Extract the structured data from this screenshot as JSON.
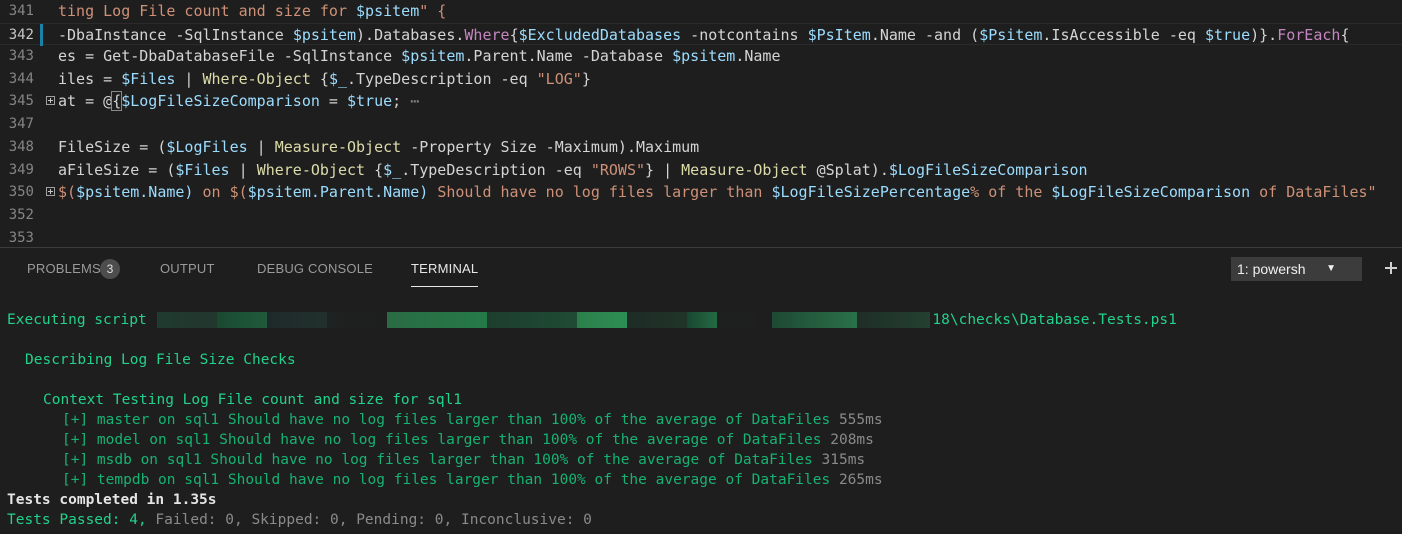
{
  "editor": {
    "lines": [
      {
        "num": "341",
        "fold": false,
        "segments": [
          {
            "t": "ting Log File count and size for ",
            "c": "str"
          },
          {
            "t": "$psitem",
            "c": "var"
          },
          {
            "t": "\" {",
            "c": "str"
          }
        ]
      },
      {
        "num": "342",
        "fold": false,
        "current": true,
        "segments": [
          {
            "t": "-DbaInstance -SqlInstance ",
            "c": "def"
          },
          {
            "t": "$psitem",
            "c": "var"
          },
          {
            "t": ").Databases.",
            "c": "def"
          },
          {
            "t": "Where",
            "c": "kw"
          },
          {
            "t": "{",
            "c": "def"
          },
          {
            "t": "$ExcludedDatabases",
            "c": "var"
          },
          {
            "t": " -notcontains ",
            "c": "def"
          },
          {
            "t": "$PsItem",
            "c": "var"
          },
          {
            "t": ".Name -and (",
            "c": "def"
          },
          {
            "t": "$Psitem",
            "c": "var"
          },
          {
            "t": ".IsAccessible -eq ",
            "c": "def"
          },
          {
            "t": "$true",
            "c": "var"
          },
          {
            "t": ")}.",
            "c": "def"
          },
          {
            "t": "ForEach",
            "c": "kw"
          },
          {
            "t": "{",
            "c": "def"
          }
        ]
      },
      {
        "num": "343",
        "fold": false,
        "segments": [
          {
            "t": "es = Get-DbaDatabaseFile -SqlInstance ",
            "c": "def"
          },
          {
            "t": "$psitem",
            "c": "var"
          },
          {
            "t": ".Parent.Name -Database ",
            "c": "def"
          },
          {
            "t": "$psitem",
            "c": "var"
          },
          {
            "t": ".Name",
            "c": "def"
          }
        ]
      },
      {
        "num": "344",
        "fold": false,
        "segments": [
          {
            "t": "iles = ",
            "c": "def"
          },
          {
            "t": "$Files",
            "c": "var"
          },
          {
            "t": " | ",
            "c": "def"
          },
          {
            "t": "Where-Object",
            "c": "fn"
          },
          {
            "t": " {",
            "c": "def"
          },
          {
            "t": "$_",
            "c": "var"
          },
          {
            "t": ".TypeDescription -eq ",
            "c": "def"
          },
          {
            "t": "\"LOG\"",
            "c": "str"
          },
          {
            "t": "}",
            "c": "def"
          }
        ]
      },
      {
        "num": "345",
        "fold": true,
        "segments": [
          {
            "t": "at = @",
            "c": "def"
          },
          {
            "t": "{",
            "c": "def",
            "box": true
          },
          {
            "t": "$LogFileSizeComparison",
            "c": "var"
          },
          {
            "t": " = ",
            "c": "def"
          },
          {
            "t": "$true",
            "c": "var"
          },
          {
            "t": ";",
            "c": "def"
          },
          {
            "t": " ⋯",
            "c": "ellipsis"
          }
        ]
      },
      {
        "num": "347",
        "fold": false,
        "segments": []
      },
      {
        "num": "348",
        "fold": false,
        "segments": [
          {
            "t": "FileSize = (",
            "c": "def"
          },
          {
            "t": "$LogFiles",
            "c": "var"
          },
          {
            "t": " | ",
            "c": "def"
          },
          {
            "t": "Measure-Object",
            "c": "fn"
          },
          {
            "t": " -Property Size -Maximum).Maximum",
            "c": "def"
          }
        ]
      },
      {
        "num": "349",
        "fold": false,
        "segments": [
          {
            "t": "aFileSize = (",
            "c": "def"
          },
          {
            "t": "$Files",
            "c": "var"
          },
          {
            "t": " | ",
            "c": "def"
          },
          {
            "t": "Where-Object",
            "c": "fn"
          },
          {
            "t": " {",
            "c": "def"
          },
          {
            "t": "$_",
            "c": "var"
          },
          {
            "t": ".TypeDescription -eq ",
            "c": "def"
          },
          {
            "t": "\"ROWS\"",
            "c": "str"
          },
          {
            "t": "} | ",
            "c": "def"
          },
          {
            "t": "Measure-Object",
            "c": "fn"
          },
          {
            "t": " @Splat).",
            "c": "def"
          },
          {
            "t": "$LogFileSizeComparison",
            "c": "var"
          }
        ]
      },
      {
        "num": "350",
        "fold": true,
        "segments": [
          {
            "t": "$(",
            "c": "str"
          },
          {
            "t": "$psitem",
            "c": "var"
          },
          {
            "t": ".Name) ",
            "c": "var"
          },
          {
            "t": "on ",
            "c": "str"
          },
          {
            "t": "$(",
            "c": "str"
          },
          {
            "t": "$psitem",
            "c": "var"
          },
          {
            "t": ".Parent.Name) ",
            "c": "var"
          },
          {
            "t": "Should have no log files larger than ",
            "c": "str"
          },
          {
            "t": "$LogFileSizePercentage",
            "c": "var"
          },
          {
            "t": "% of the ",
            "c": "str"
          },
          {
            "t": "$LogFileSizeComparison",
            "c": "var"
          },
          {
            "t": " of DataFiles\"",
            "c": "str"
          }
        ]
      },
      {
        "num": "352",
        "fold": false,
        "segments": []
      },
      {
        "num": "353",
        "fold": false,
        "segments": []
      }
    ]
  },
  "panel": {
    "tabs": [
      {
        "label": "PROBLEMS",
        "badge": "3",
        "active": false
      },
      {
        "label": "OUTPUT",
        "active": false
      },
      {
        "label": "DEBUG CONSOLE",
        "active": false
      },
      {
        "label": "TERMINAL",
        "active": true
      }
    ],
    "terminal_select": {
      "value": "1: powershell",
      "display": "1: powersh"
    },
    "add_icon": "plus-icon"
  },
  "terminal": {
    "executing_prefix": "Executing script ",
    "executing_suffix": "18\\checks\\Database.Tests.ps1",
    "describing": "Describing Log File Size Checks",
    "context": "Context Testing Log File count and size for sql1",
    "tests": [
      {
        "text": "[+] master on sql1 Should have no log files larger than 100% of the average of DataFiles",
        "time": "555ms"
      },
      {
        "text": "[+] model on sql1 Should have no log files larger than 100% of the average of DataFiles",
        "time": "208ms"
      },
      {
        "text": "[+] msdb on sql1 Should have no log files larger than 100% of the average of DataFiles",
        "time": "315ms"
      },
      {
        "text": "[+] tempdb on sql1 Should have no log files larger than 100% of the average of DataFiles",
        "time": "265ms"
      }
    ],
    "completed": "Tests completed in 1.35s",
    "summary_passed": "Tests Passed: 4,",
    "summary_rest": " Failed: 0, Skipped: 0, Pending: 0, Inconclusive: 0"
  },
  "colors": {
    "editor_bg": "#1e1e1e",
    "terminal_green": "#23d18b",
    "string": "#ce9178",
    "variable": "#9cdcfe",
    "keyword": "#c586c0",
    "function": "#dcdcaa"
  }
}
